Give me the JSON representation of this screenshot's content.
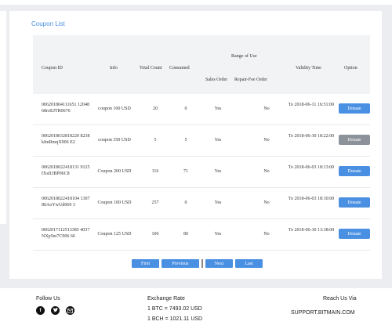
{
  "card": {
    "title": "Coupon List"
  },
  "headers": {
    "coupon_id": "Coupon ID",
    "info": "Info",
    "total_count": "Total Count",
    "consumed": "Consumed",
    "range_of_use": "Range of Use",
    "sales_order": "Sales Order",
    "repair_fee_order": "Repair-Fee Order",
    "validity_time": "Validity Time",
    "option": "Option"
  },
  "rows": [
    {
      "id": "006201804111651 1204868roEJTR0676",
      "info": "coupon 100 USD",
      "total": "20",
      "consumed": "0",
      "sales": "Yes",
      "repair": "No",
      "validity": "To 2018-06-11 16:51:00",
      "option": "Donate",
      "option_state": "active"
    },
    {
      "id": "0062018032818220 8238kImRmqX906 E2",
      "info": "coupon 350 USD",
      "total": "5",
      "consumed": "5",
      "sales": "Yes",
      "repair": "No",
      "validity": "To 2018-06-30 18:22:00",
      "option": "Donate",
      "option_state": "disabled"
    },
    {
      "id": "0062018022418131 9125fXsft3BP06C8",
      "info": "Coupon 200 USD",
      "total": "116",
      "consumed": "71",
      "sales": "Yes",
      "repair": "No",
      "validity": "To 2018-06-03 18:13:00",
      "option": "Donate",
      "option_state": "active"
    },
    {
      "id": "0062018022418104 130780AoYwUd069 3",
      "info": "Coupon 100 USD",
      "total": "257",
      "consumed": "0",
      "sales": "Yes",
      "repair": "No",
      "validity": "To 2018-06-03 18:10:00",
      "option": "Donate",
      "option_state": "active"
    },
    {
      "id": "0062017112513385 4037NXp5m7C906 66",
      "info": "Coupon 125 USD",
      "total": "106",
      "consumed": "80",
      "sales": "Yes",
      "repair": "No",
      "validity": "To 2018-06-30 13:38:00",
      "option": "Donate",
      "option_state": "active"
    }
  ],
  "pagination": {
    "first": "First",
    "previous": "Previous",
    "next": "Next",
    "last": "Last"
  },
  "footer": {
    "follow_us": "Follow Us",
    "exchange_rate": "Exchange Rate",
    "btc_rate": "1 BTC = 7493.02 USD",
    "bch_rate": "1 BCH = 1021.11 USD",
    "reach_us": "Reach Us Via",
    "support_email": "SUPPORT.BITMAIN.COM"
  },
  "icons": {
    "facebook": "facebook-icon",
    "twitter": "twitter-icon",
    "email": "email-icon"
  },
  "colors": {
    "accent": "#4a90e2",
    "disabled_button": "#8c9299",
    "header_bg": "#f2f3f5",
    "page_bg": "#ecedf0"
  }
}
